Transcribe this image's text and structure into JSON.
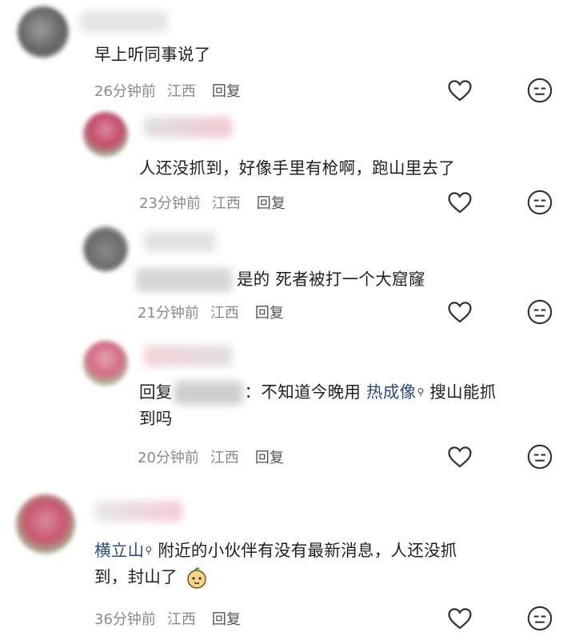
{
  "comments": [
    {
      "text": "早上听同事说了",
      "time": "26分钟前",
      "location": "江西",
      "reply": "回复"
    },
    {
      "text": "人还没抓到，好像手里有枪啊，跑山里去了",
      "time": "23分钟前",
      "location": "江西",
      "reply": "回复"
    },
    {
      "text": "是的 死者被打一个大窟窿",
      "time": "21分钟前",
      "location": "江西",
      "reply": "回复"
    },
    {
      "reply_prefix": "回复",
      "text_before": "：不知道今晚用 ",
      "link": "热成像",
      "text_after_line1": " 搜山能抓",
      "text_line2": "到吗",
      "time": "20分钟前",
      "location": "江西",
      "reply": "回复"
    },
    {
      "link": "横立山",
      "text_line1": " 附近的小伙伴有没有最新消息，人还没抓",
      "text_line2": "到，封山了",
      "time": "36分钟前",
      "location": "江西",
      "reply": "回复"
    }
  ],
  "icons": {
    "like": "heart-outline-icon",
    "dislike": "meh-face-icon",
    "search": "search-icon",
    "emoji": "cute-face-emoji"
  }
}
